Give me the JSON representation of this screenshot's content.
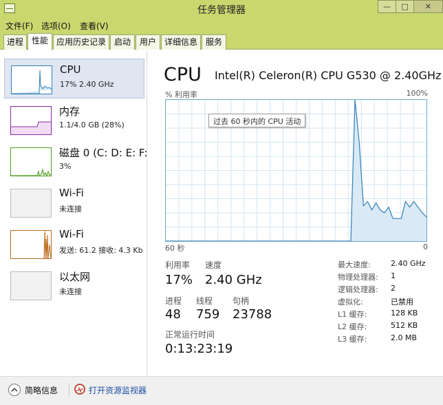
{
  "window": {
    "title": "任务管理器",
    "min_symbol": "—",
    "max_symbol": "□",
    "close_symbol": "✕"
  },
  "menu": [
    "文件(F)",
    "选项(O)",
    "查看(V)"
  ],
  "tabs": [
    "进程",
    "性能",
    "应用历史记录",
    "启动",
    "用户",
    "详细信息",
    "服务"
  ],
  "active_tab": "性能",
  "sidebar": {
    "items": [
      {
        "name": "CPU",
        "detail": "17% 2.40 GHz",
        "color": "#2f7fb5",
        "selected": true
      },
      {
        "name": "内存",
        "detail": "1.1/4.0 GB (28%)",
        "color": "#8b29a8"
      },
      {
        "name": "磁盘 0 (C: D: E: F:",
        "detail": "3%",
        "color": "#4e9a1e"
      },
      {
        "name": "Wi-Fi",
        "detail": "未连接",
        "color": "#999999"
      },
      {
        "name": "Wi-Fi",
        "detail": "发送: 61.2  接收: 4.3 Kb",
        "color": "#b86a1c"
      },
      {
        "name": "以太网",
        "detail": "未连接",
        "color": "#999999"
      }
    ]
  },
  "main": {
    "title": "CPU",
    "model": "Intel(R) Celeron(R) CPU G530 @ 2.40GHz",
    "graph": {
      "y_label": "% 利用率",
      "y_max_label": "100%",
      "tooltip": "过去 60 秒内的 CPU 活动",
      "x_left_label": "60 秒",
      "x_right_label": "0",
      "line_color": "#2f7fb5",
      "fill_color": "#d9e9f5",
      "grid_color": "#d3e4ef",
      "utilization_series": [
        0,
        0,
        0,
        0,
        0,
        0,
        0,
        0,
        0,
        0,
        0,
        0,
        0,
        0,
        0,
        0,
        0,
        0,
        0,
        0,
        0,
        0,
        0,
        0,
        0,
        0,
        0,
        0,
        0,
        0,
        0,
        0,
        0,
        0,
        0,
        0,
        0,
        0,
        0,
        0,
        0,
        0,
        0,
        0,
        0,
        100,
        70,
        25,
        28,
        22,
        27,
        22,
        20,
        24,
        16,
        16,
        16,
        28,
        24,
        28,
        24,
        20,
        17
      ]
    },
    "stats": {
      "utilization_label": "利用率",
      "utilization_value": "17%",
      "speed_label": "速度",
      "speed_value": "2.40 GHz",
      "processes_label": "进程",
      "processes_value": "48",
      "threads_label": "线程",
      "threads_value": "759",
      "handles_label": "句柄",
      "handles_value": "23788",
      "uptime_label": "正常运行时间",
      "uptime_value": "0:13:23:19"
    },
    "specs": [
      {
        "label": "最大速度:",
        "value": "2.40 GHz"
      },
      {
        "label": "物理处理器:",
        "value": "1"
      },
      {
        "label": "逻辑处理器:",
        "value": "2"
      },
      {
        "label": "虚拟化:",
        "value": "已禁用"
      },
      {
        "label": "L1 缓存:",
        "value": "128 KB"
      },
      {
        "label": "L2 缓存:",
        "value": "512 KB"
      },
      {
        "label": "L3 缓存:",
        "value": "2.0 MB"
      }
    ]
  },
  "footer": {
    "collapse_label": "简略信息",
    "monitor_link": "打开资源监视器",
    "collapse_icon": "chevron-up-icon",
    "monitor_icon": "resource-monitor-icon"
  }
}
